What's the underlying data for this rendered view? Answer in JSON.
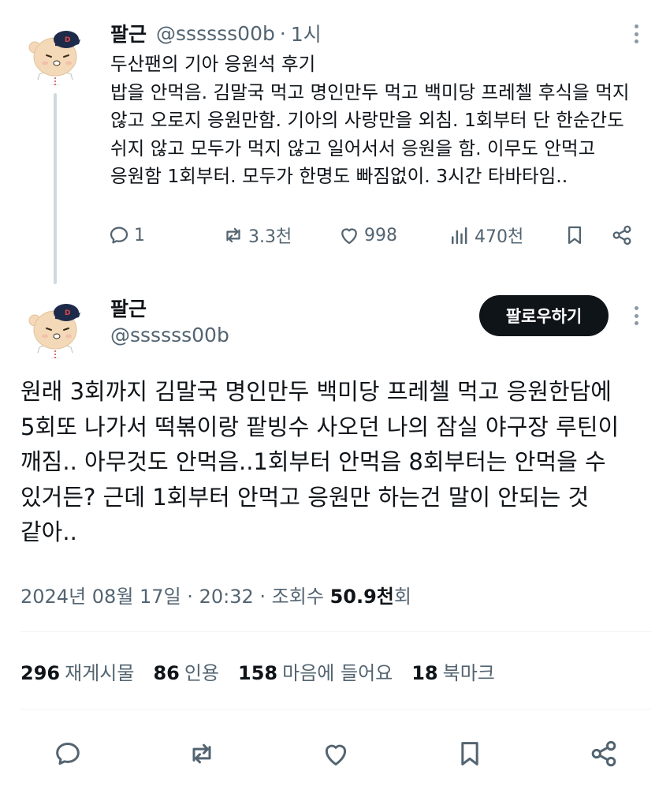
{
  "reply_tweet": {
    "author_name": "팔근",
    "handle": "@ssssss00b",
    "separator": "·",
    "time": "1시",
    "lines": [
      "두산팬의 기아 응원석 후기",
      "밥을 안먹음. 김말국 먹고 명인만두 먹고 백미당  프레첼 후식을 먹지",
      "않고 오로지 응원만함. 기아의 사랑만을 외침. 1회부터 단 한순간도",
      "쉬지 않고 모두가 먹지 않고 일어서서 응원을 함. 이무도 안먹고",
      "응원함 1회부터. 모두가 한명도 빠짐없이. 3시간 타바타임.."
    ],
    "actions": {
      "replies": "1",
      "retweets": "3.3천",
      "likes": "998",
      "views": "470천"
    }
  },
  "main_tweet": {
    "author_name": "팔근",
    "handle": "@ssssss00b",
    "follow_label": "팔로우하기",
    "lines": [
      "원래 3회까지 김말국 명인만두 백미당 프레첼 먹고 응원한담에",
      "5회또 나가서 떡볶이랑 팥빙수 사오던 나의 잠실 야구장 루틴이",
      "깨짐.. 아무것도 안먹음..1회부터 안먹음 8회부터는 안먹을 수",
      "있거든? 근데 1회부터 안먹고 응원만 하는건 말이 안되는 것",
      "같아.."
    ],
    "date": "2024년 08월 17일",
    "time": "20:32",
    "separator": "·",
    "views_label": "조회수",
    "views_value": "50.9천",
    "views_suffix": "회",
    "stats": [
      {
        "value": "296",
        "label": "재게시물"
      },
      {
        "value": "86",
        "label": "인용"
      },
      {
        "value": "158",
        "label": "마음에 들어요"
      },
      {
        "value": "18",
        "label": "북마크"
      }
    ]
  },
  "colors": {
    "text": "#0f1419",
    "secondary": "#536471",
    "follow_bg": "#0f1419",
    "divider": "#eff3f4",
    "thread_line": "#cfd9de",
    "avatar_fill": "#f3d9b8",
    "cap": "#1d2a4a"
  }
}
